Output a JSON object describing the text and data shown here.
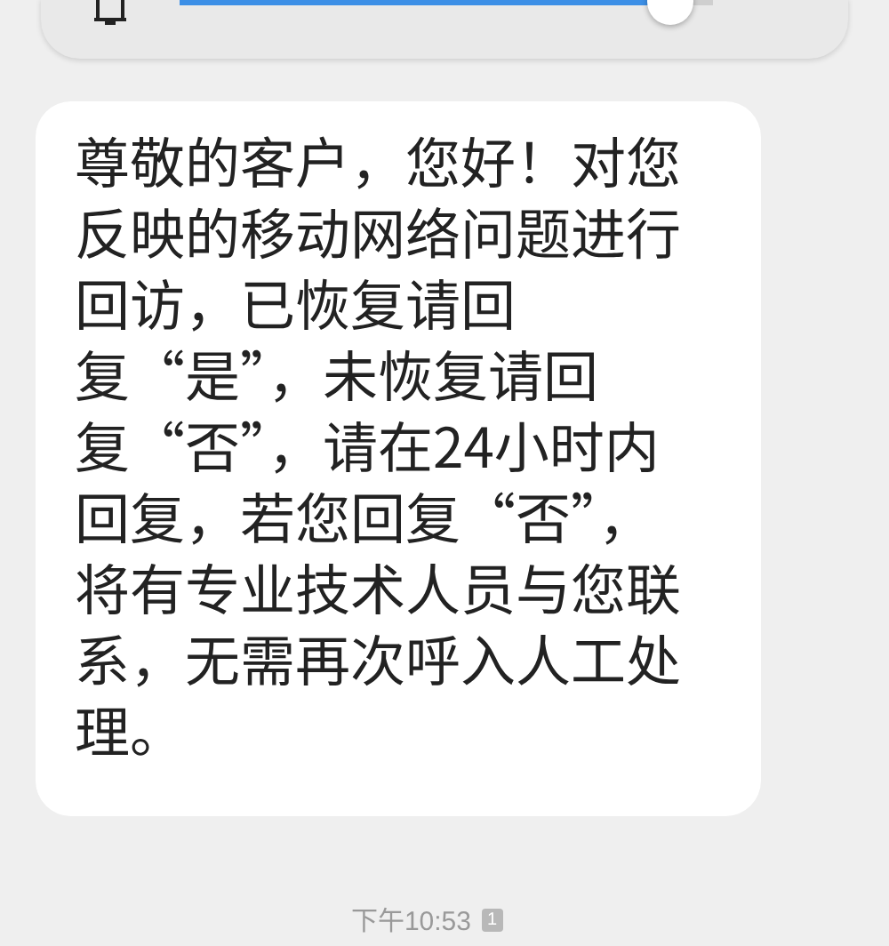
{
  "volume_panel": {
    "level": 0.96
  },
  "message": {
    "lines": [
      "尊敬的客户，您好！对您",
      "反映的移动网络问题进行",
      "回访，已恢复请回",
      "复“是”，未恢复请回",
      "复“否”，请在24小时内",
      "回复，若您回复“否”，",
      "将有专业技术人员与您联",
      "系，无需再次呼入人工处",
      "理。"
    ]
  },
  "timestamp": {
    "time": "下午10:53",
    "sim": "1"
  }
}
